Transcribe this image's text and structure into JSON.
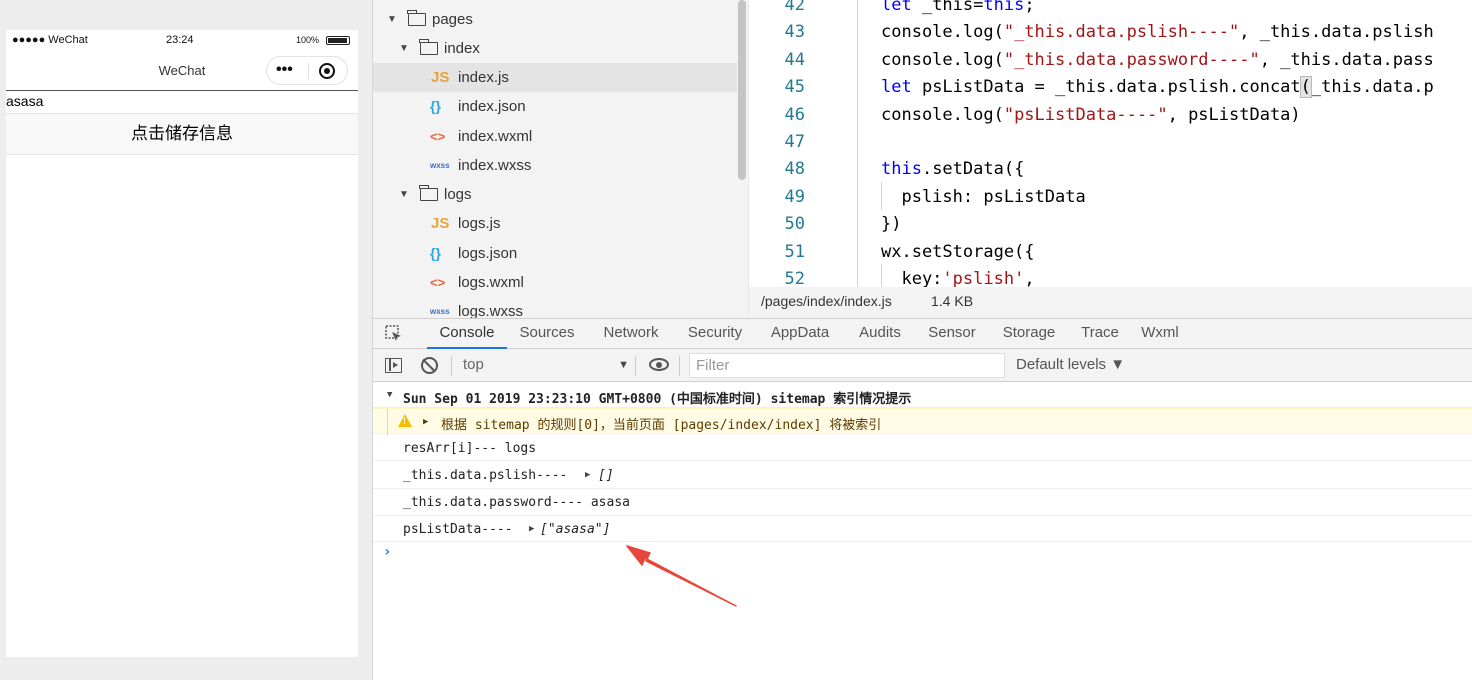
{
  "simulator": {
    "status_left": "●●●●● WeChat",
    "status_time": "23:24",
    "status_battery": "100%",
    "nav_title": "WeChat",
    "capsule_dots": "•••",
    "password_text": "asasa",
    "store_button": "点击储存信息"
  },
  "file_tree": {
    "items": [
      {
        "label": "pages",
        "icon": "folder-open-icon"
      },
      {
        "label": "index",
        "icon": "folder-open-icon"
      },
      {
        "label": "index.js",
        "icon": "js-file-icon",
        "glyph": "JS"
      },
      {
        "label": "index.json",
        "icon": "json-file-icon",
        "glyph": "{}"
      },
      {
        "label": "index.wxml",
        "icon": "wxml-file-icon",
        "glyph": "<>"
      },
      {
        "label": "index.wxss",
        "icon": "wxss-file-icon",
        "glyph": "wxss"
      },
      {
        "label": "logs",
        "icon": "folder-open-icon"
      },
      {
        "label": "logs.js",
        "icon": "js-file-icon",
        "glyph": "JS"
      },
      {
        "label": "logs.json",
        "icon": "json-file-icon",
        "glyph": "{}"
      },
      {
        "label": "logs.wxml",
        "icon": "wxml-file-icon",
        "glyph": "<>"
      },
      {
        "label": "logs.wxss",
        "icon": "wxss-file-icon",
        "glyph": "wxss"
      }
    ]
  },
  "editor": {
    "line_numbers": [
      "42",
      "43",
      "44",
      "45",
      "46",
      "47",
      "48",
      "49",
      "50",
      "51",
      "52"
    ],
    "lines": [
      {
        "parts": [
          [
            "kw",
            "let"
          ],
          [
            "pr",
            " _this="
          ],
          [
            "kw",
            "this"
          ],
          [
            "pr",
            ";"
          ]
        ]
      },
      {
        "parts": [
          [
            "pr",
            "console.log("
          ],
          [
            "str",
            "\"_this.data.pslish----\""
          ],
          [
            "pr",
            ", _this.data.pslish"
          ]
        ]
      },
      {
        "parts": [
          [
            "pr",
            "console.log("
          ],
          [
            "str",
            "\"_this.data.password----\""
          ],
          [
            "pr",
            ", _this.data.pass"
          ]
        ]
      },
      {
        "parts": [
          [
            "kw",
            "let"
          ],
          [
            "pr",
            " psListData = _this.data.pslish.concat"
          ],
          [
            "hl",
            "("
          ],
          [
            "pr",
            "_this.data.p"
          ]
        ]
      },
      {
        "parts": [
          [
            "pr",
            "console.log("
          ],
          [
            "str",
            "\"psListData----\""
          ],
          [
            "pr",
            ", psListData)"
          ]
        ]
      },
      {
        "parts": [
          [
            "pr",
            ""
          ]
        ]
      },
      {
        "parts": [
          [
            "kw",
            "this"
          ],
          [
            "pr",
            ".setData({"
          ]
        ]
      },
      {
        "parts": [
          [
            "pr",
            "  pslish: psListData"
          ]
        ]
      },
      {
        "parts": [
          [
            "pr",
            "})"
          ]
        ]
      },
      {
        "parts": [
          [
            "pr",
            "wx.setStorage({"
          ]
        ]
      },
      {
        "parts": [
          [
            "pr",
            "  key:"
          ],
          [
            "str",
            "'pslish'"
          ],
          [
            "pr",
            ","
          ]
        ]
      }
    ],
    "status_path": "/pages/index/index.js",
    "status_size": "1.4 KB"
  },
  "devtools": {
    "tabs": [
      "Console",
      "Sources",
      "Network",
      "Security",
      "AppData",
      "Audits",
      "Sensor",
      "Storage",
      "Trace",
      "Wxml"
    ],
    "active_tab": "Console",
    "context": "top",
    "filter_placeholder": "Filter",
    "levels": "Default levels ▼"
  },
  "console": {
    "group_header": "Sun Sep 01 2019 23:23:10 GMT+0800 (中国标准时间) sitemap 索引情况提示",
    "warning": "根据 sitemap 的规则[0]，当前页面 [pages/index/index] 将被索引",
    "log1": "resArr[i]--- logs",
    "log2_label": "_this.data.pslish----",
    "log2_value": "[]",
    "log3": "_this.data.password---- asasa",
    "log4_label": "psListData----",
    "log4_value": "[\"asasa\"]",
    "prompt": "›"
  },
  "colors": {
    "accent": "#1a73e8",
    "annotation_arrow": "#e8463a",
    "warning_bg": "#fffbe5",
    "keyword": "#0000ff",
    "string": "#a31515"
  }
}
